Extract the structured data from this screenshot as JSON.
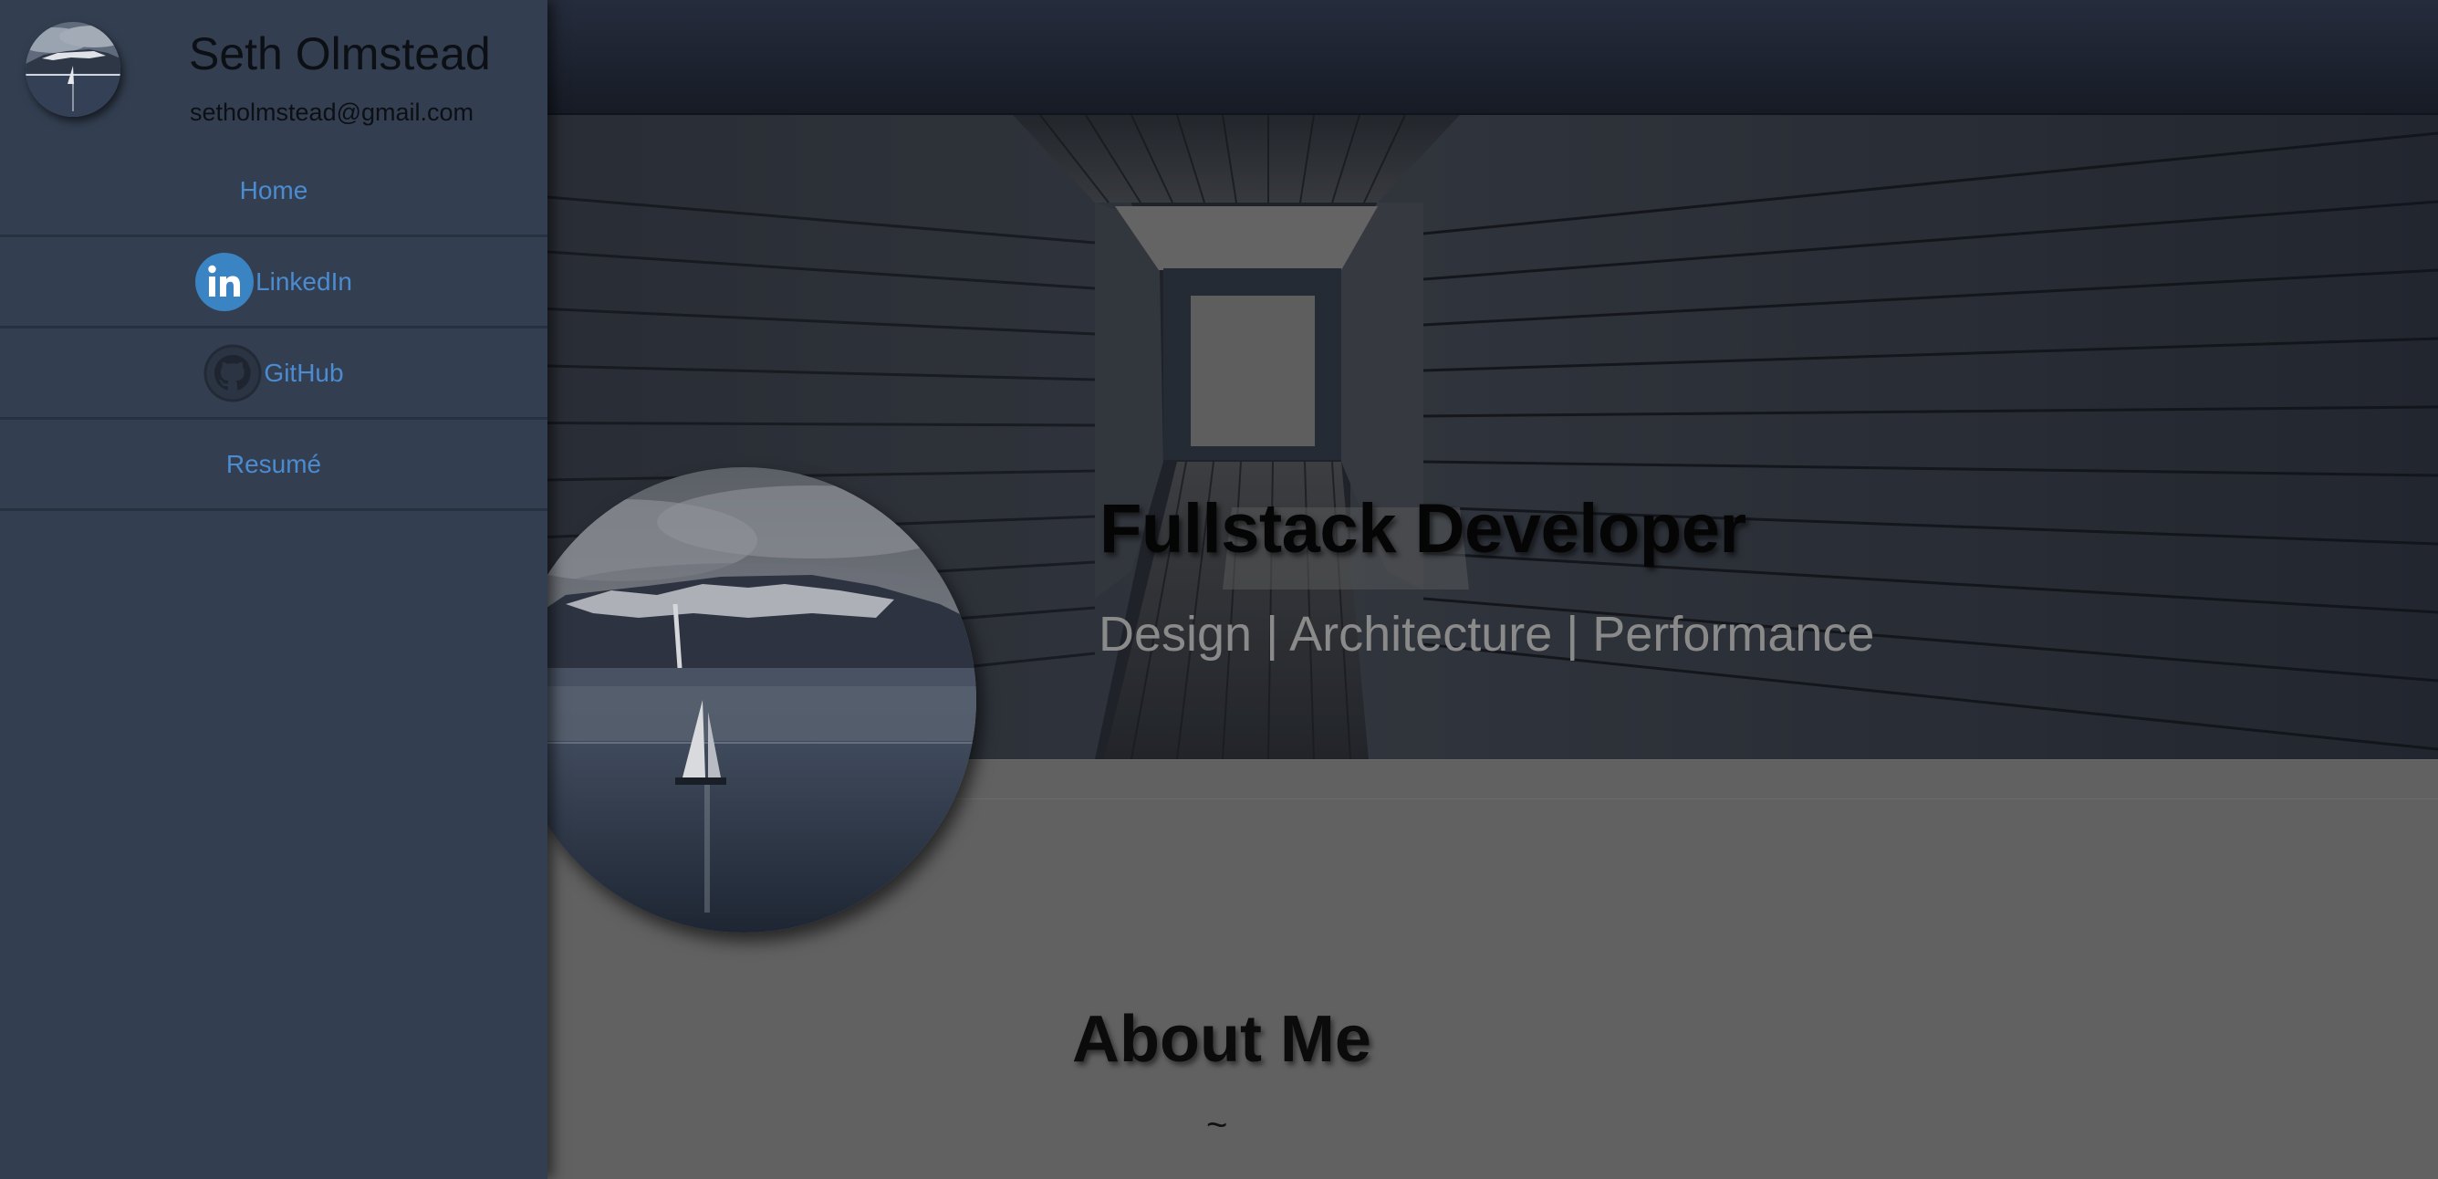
{
  "sidebar": {
    "name": "Seth Olmstead",
    "email": "setholmstead@gmail.com",
    "avatar_icon": "lake-mountain-avatar",
    "items": [
      {
        "label": "Home",
        "icon": ""
      },
      {
        "label": "LinkedIn",
        "icon": "linkedin-icon"
      },
      {
        "label": "GitHub",
        "icon": "github-icon"
      },
      {
        "label": "Resumé",
        "icon": ""
      }
    ]
  },
  "hero": {
    "title": "Fullstack Developer",
    "subtitle": "Design | Architecture | Performance"
  },
  "about": {
    "title": "About Me",
    "divider": "~"
  },
  "colors": {
    "sidebar_bg": "#333f51",
    "link": "#4b8bd0",
    "linkedin": "#3b84c4",
    "overlay": "#616161"
  }
}
